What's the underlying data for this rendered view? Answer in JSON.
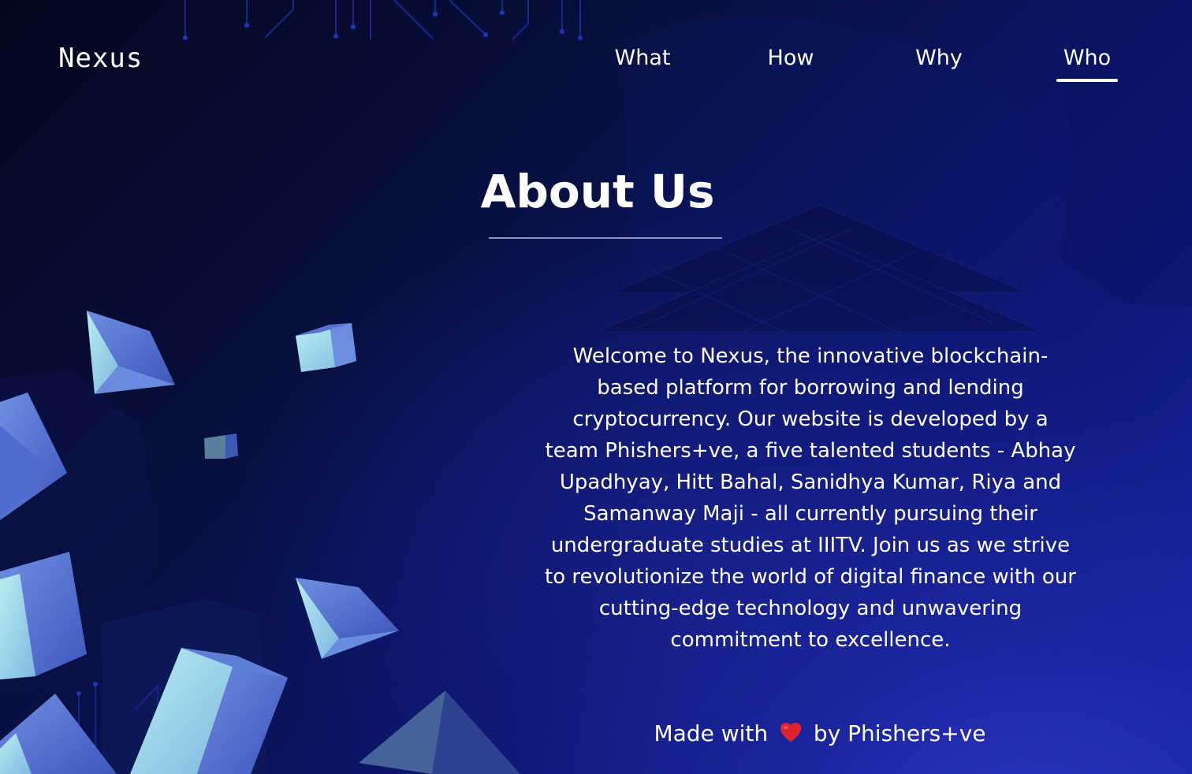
{
  "brand": {
    "logo_text": "Nexus"
  },
  "nav": {
    "items": [
      {
        "label": "What"
      },
      {
        "label": "How"
      },
      {
        "label": "Why"
      },
      {
        "label": "Who"
      }
    ],
    "active_label": "Who"
  },
  "main": {
    "title": "About Us",
    "body": "Welcome to Nexus, the innovative blockchain-based platform for borrowing and lending cryptocurrency. Our website is developed by a team Phishers+ve, a five talented students - Abhay Upadhyay, Hitt Bahal, Sanidhya Kumar, Riya and Samanway Maji - all currently pursuing their undergraduate studies at IIITV. Join us as we strive to revolutionize the world of digital finance with our cutting-edge technology and unwavering commitment to excellence."
  },
  "footer": {
    "prefix": "Made with",
    "icon": "heart-icon",
    "suffix": "by Phishers+ve"
  },
  "colors": {
    "background_dark": "#04071f",
    "background_light": "#1a24a8",
    "cube_light": "#a8e3e8",
    "cube_mid": "#5c7fd8",
    "cube_dark": "#3a4fb4",
    "heart": "#e0242f",
    "text": "#ffffff"
  }
}
